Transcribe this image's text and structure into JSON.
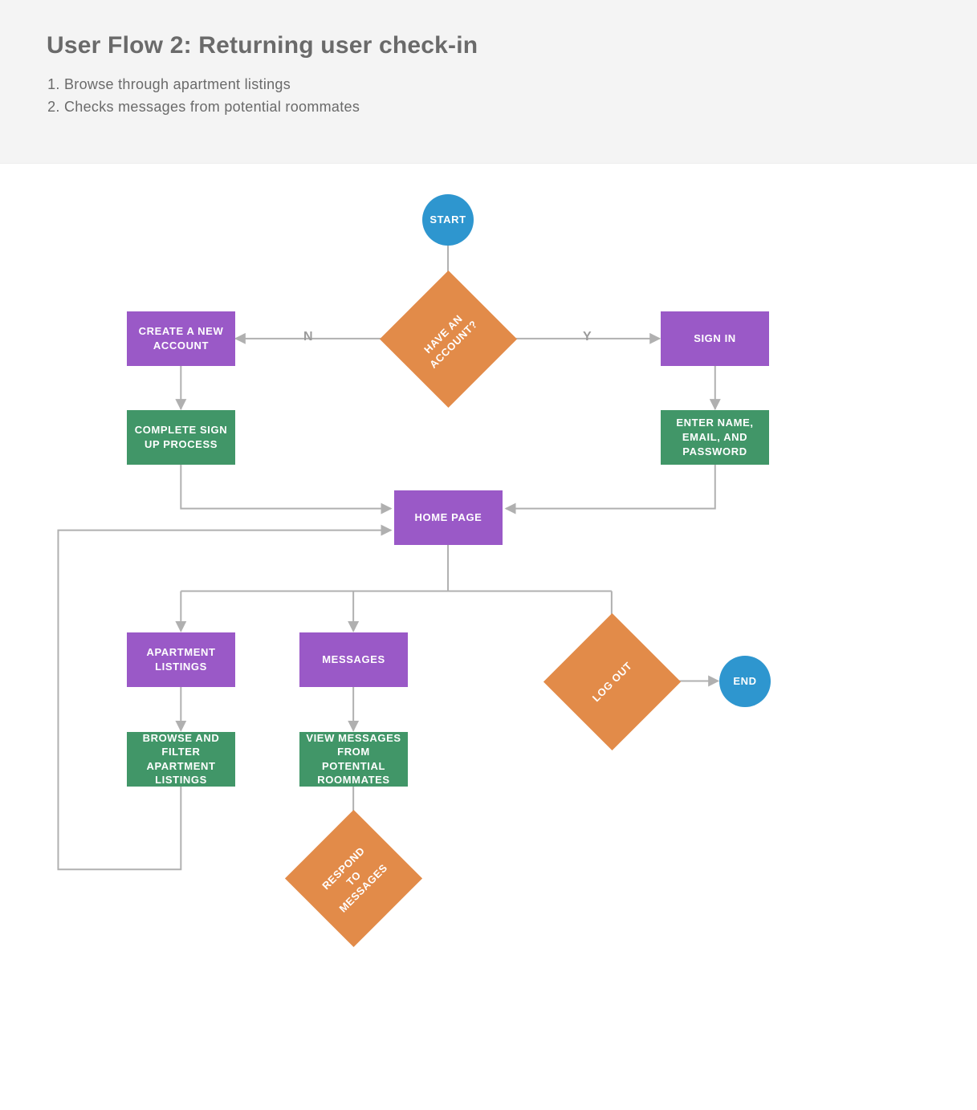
{
  "header": {
    "title": "User Flow 2: Returning user check-in",
    "steps": [
      "Browse through apartment listings",
      "Checks messages from potential roommates"
    ]
  },
  "nodes": {
    "start": "START",
    "have_account": "HAVE AN ACCOUNT?",
    "create_account": "CREATE A NEW ACCOUNT",
    "sign_in": "SIGN IN",
    "complete_signup": "COMPLETE SIGN UP PROCESS",
    "enter_credentials": "ENTER NAME, EMAIL, AND PASSWORD",
    "home_page": "HOME PAGE",
    "apartment_listings": "APARTMENT LISTINGS",
    "messages": "MESSAGES",
    "log_out": "LOG OUT",
    "end": "END",
    "browse_filter": "BROWSE AND FILTER APARTMENT LISTINGS",
    "view_messages": "VIEW MESSAGES FROM POTENTIAL ROOMMATES",
    "respond": "RESPOND TO MESSAGES"
  },
  "edge_labels": {
    "no": "N",
    "yes": "Y"
  },
  "colors": {
    "circle": "#2e96cf",
    "diamond": "#e28b49",
    "page": "#9a59c7",
    "action": "#419668",
    "connector": "#b0b0b0",
    "text_muted": "#6a6a6a"
  }
}
